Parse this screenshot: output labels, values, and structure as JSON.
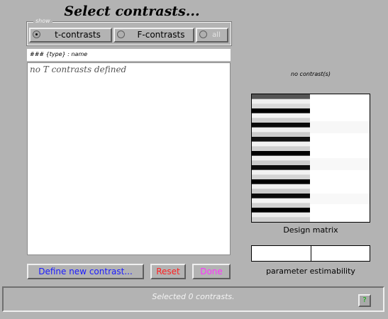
{
  "title": "Select contrasts...",
  "show_group": {
    "legend": "show",
    "options": [
      {
        "label": "t-contrasts",
        "selected": true
      },
      {
        "label": "F-contrasts",
        "selected": false
      },
      {
        "label": "all",
        "selected": false
      }
    ]
  },
  "list": {
    "header": "### {type} : name",
    "empty_message": "no T contrasts defined"
  },
  "buttons": {
    "define": "Define new contrast...",
    "reset": "Reset",
    "done": "Done"
  },
  "design": {
    "contrast_caption": "no contrast(s)",
    "matrix_label": "Design matrix",
    "estimability_label": "parameter estimability"
  },
  "status": {
    "text": "Selected 0 contrasts.",
    "help_label": "?"
  },
  "colors": {
    "background": "#b3b3b3",
    "define_text": "#1a1aff",
    "reset_text": "#ff2020",
    "done_text": "#ff33ff",
    "help_text": "#00b000"
  }
}
